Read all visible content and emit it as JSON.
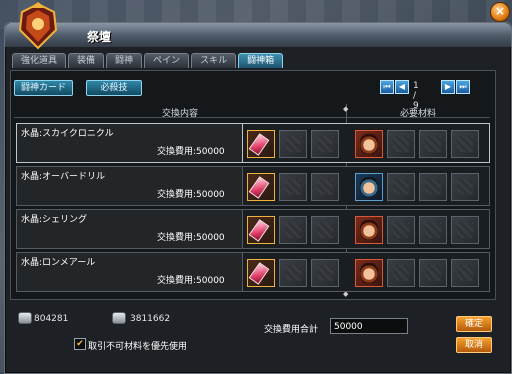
{
  "window": {
    "title": "祭壇"
  },
  "tabs": [
    {
      "label": "強化道具",
      "active": false
    },
    {
      "label": "装備",
      "active": false
    },
    {
      "label": "闘神",
      "active": false
    },
    {
      "label": "ペイン",
      "active": false
    },
    {
      "label": "スキル",
      "active": false
    },
    {
      "label": "闘神箱",
      "active": true
    }
  ],
  "subtabs": {
    "card": "闘神カード",
    "weapon": "必殺技"
  },
  "pager": {
    "text": "1 / 9"
  },
  "headers": {
    "exchange": "交換内容",
    "materials": "必要材料"
  },
  "rows": [
    {
      "name": "水晶:スカイクロニクル",
      "cost": "交換費用:50000",
      "selected": true
    },
    {
      "name": "水晶:オーバードリル",
      "cost": "交換費用:50000",
      "selected": false
    },
    {
      "name": "水晶:シェリング",
      "cost": "交換費用:50000",
      "selected": false
    },
    {
      "name": "水晶:ロンメアール",
      "cost": "交換費用:50000",
      "selected": false
    }
  ],
  "currency": {
    "gold": "804281",
    "coin": "3811662"
  },
  "total": {
    "label": "交換費用合計",
    "value": "50000"
  },
  "option": {
    "label": "取引不可材料を優先使用",
    "checked": true
  },
  "buttons": {
    "confirm": "確定",
    "cancel": "取消",
    "close": "×"
  },
  "colors": {
    "accent": "#2f87a8",
    "button_orange": "#f4a12f",
    "panel_bg": "#15181b"
  }
}
